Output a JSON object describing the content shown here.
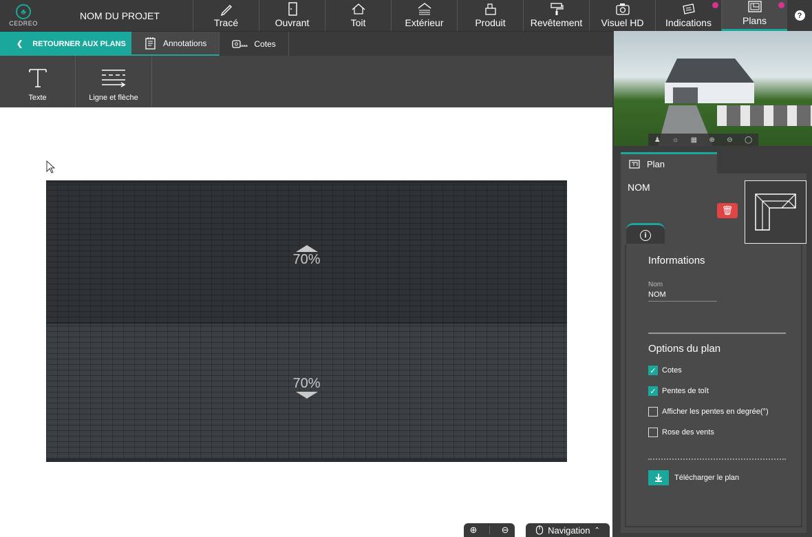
{
  "header": {
    "logo_text": "CEDREO",
    "project_name": "NOM DU PROJET",
    "tabs": [
      {
        "label": "Tracé"
      },
      {
        "label": "Ouvrant"
      },
      {
        "label": "Toit"
      },
      {
        "label": "Extérieur"
      },
      {
        "label": "Produit"
      },
      {
        "label": "Revêtement"
      },
      {
        "label": "Visuel HD"
      },
      {
        "label": "Indications"
      },
      {
        "label": "Plans"
      }
    ],
    "help": "?"
  },
  "subbar": {
    "back_label": "RETOURNER AUX PLANS",
    "tabs": [
      {
        "label": "Annotations"
      },
      {
        "label": "Cotes"
      }
    ]
  },
  "tools": [
    {
      "label": "Texte"
    },
    {
      "label": "Ligne et flèche"
    }
  ],
  "canvas": {
    "top_slope": "70%",
    "bottom_slope": "70%"
  },
  "bottom": {
    "navigation_label": "Navigation"
  },
  "right_panel": {
    "tab_label": "Plan",
    "nom_title": "NOM",
    "informations_title": "Informations",
    "name_field_label": "Nom",
    "name_field_value": "NOM",
    "options_title": "Options du plan",
    "options": [
      {
        "label": "Cotes",
        "checked": true
      },
      {
        "label": "Pentes de toît",
        "checked": true
      },
      {
        "label": "Afficher les pentes en degrée(°)",
        "checked": false
      },
      {
        "label": "Rose des vents",
        "checked": false
      }
    ],
    "download_label": "Télécharger le plan"
  },
  "colors": {
    "accent": "#1aa89c",
    "notification": "#d6338f",
    "delete": "#e04545"
  }
}
